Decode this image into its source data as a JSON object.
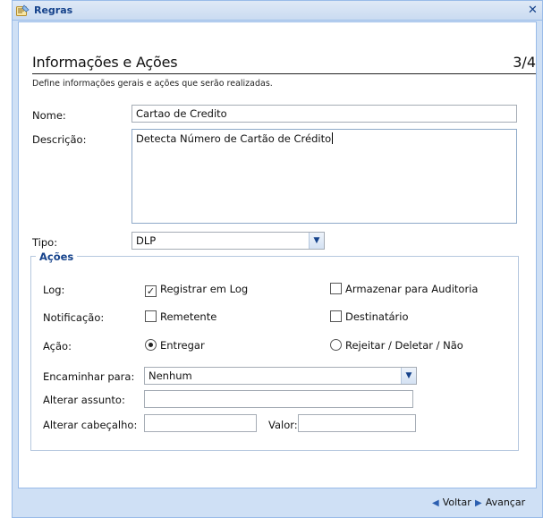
{
  "window": {
    "title": "Regras",
    "icon": "rules-wizard-icon",
    "close_icon": "close-icon",
    "close_glyph": "✕"
  },
  "header": {
    "title": "Informações e Ações",
    "step": "3/4",
    "subtitle": "Define informações gerais e ações que serão realizadas."
  },
  "form": {
    "nome_label": "Nome:",
    "nome_value": "Cartao de Credito",
    "descricao_label": "Descrição:",
    "descricao_value": "Detecta Número de Cartão de Crédito",
    "tipo_label": "Tipo:",
    "tipo_value": "DLP"
  },
  "acoes": {
    "legend": "Ações",
    "log_label": "Log:",
    "registrar_log": {
      "label": "Registrar em Log",
      "checked": true
    },
    "armazenar_auditoria": {
      "label": "Armazenar para Auditoria",
      "checked": false
    },
    "notificacao_label": "Notificação:",
    "remetente": {
      "label": "Remetente",
      "checked": false
    },
    "destinatario": {
      "label": "Destinatário",
      "checked": false
    },
    "acao_label": "Ação:",
    "entregar": {
      "label": "Entregar",
      "selected": true
    },
    "rejeitar": {
      "label": "Rejeitar / Deletar / Não",
      "selected": false
    },
    "encaminhar_label": "Encaminhar para:",
    "encaminhar_value": "Nenhum",
    "alterar_assunto_label": "Alterar assunto:",
    "alterar_assunto_value": "",
    "alterar_cabecalho_label": "Alterar cabeçalho:",
    "alterar_cabecalho_value": "",
    "valor_label": "Valor:",
    "valor_value": ""
  },
  "footer": {
    "back_label": "Voltar",
    "next_label": "Avançar"
  },
  "colors": {
    "accent": "#15428b",
    "frame": "#cfe0f5",
    "border": "#99bbe8"
  }
}
